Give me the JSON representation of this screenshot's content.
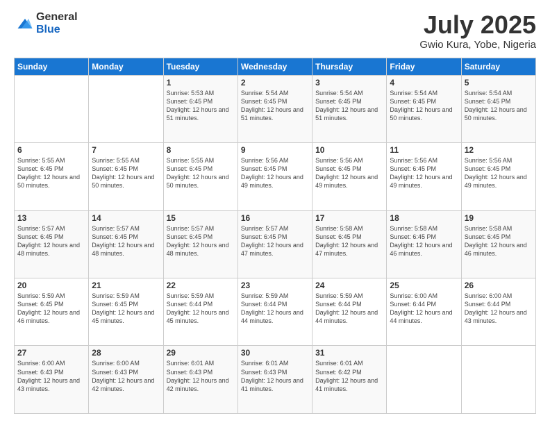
{
  "logo": {
    "general": "General",
    "blue": "Blue"
  },
  "header": {
    "title": "July 2025",
    "subtitle": "Gwio Kura, Yobe, Nigeria"
  },
  "weekdays": [
    "Sunday",
    "Monday",
    "Tuesday",
    "Wednesday",
    "Thursday",
    "Friday",
    "Saturday"
  ],
  "weeks": [
    [
      {
        "day": "",
        "sunrise": "",
        "sunset": "",
        "daylight": ""
      },
      {
        "day": "",
        "sunrise": "",
        "sunset": "",
        "daylight": ""
      },
      {
        "day": "1",
        "sunrise": "Sunrise: 5:53 AM",
        "sunset": "Sunset: 6:45 PM",
        "daylight": "Daylight: 12 hours and 51 minutes."
      },
      {
        "day": "2",
        "sunrise": "Sunrise: 5:54 AM",
        "sunset": "Sunset: 6:45 PM",
        "daylight": "Daylight: 12 hours and 51 minutes."
      },
      {
        "day": "3",
        "sunrise": "Sunrise: 5:54 AM",
        "sunset": "Sunset: 6:45 PM",
        "daylight": "Daylight: 12 hours and 51 minutes."
      },
      {
        "day": "4",
        "sunrise": "Sunrise: 5:54 AM",
        "sunset": "Sunset: 6:45 PM",
        "daylight": "Daylight: 12 hours and 50 minutes."
      },
      {
        "day": "5",
        "sunrise": "Sunrise: 5:54 AM",
        "sunset": "Sunset: 6:45 PM",
        "daylight": "Daylight: 12 hours and 50 minutes."
      }
    ],
    [
      {
        "day": "6",
        "sunrise": "Sunrise: 5:55 AM",
        "sunset": "Sunset: 6:45 PM",
        "daylight": "Daylight: 12 hours and 50 minutes."
      },
      {
        "day": "7",
        "sunrise": "Sunrise: 5:55 AM",
        "sunset": "Sunset: 6:45 PM",
        "daylight": "Daylight: 12 hours and 50 minutes."
      },
      {
        "day": "8",
        "sunrise": "Sunrise: 5:55 AM",
        "sunset": "Sunset: 6:45 PM",
        "daylight": "Daylight: 12 hours and 50 minutes."
      },
      {
        "day": "9",
        "sunrise": "Sunrise: 5:56 AM",
        "sunset": "Sunset: 6:45 PM",
        "daylight": "Daylight: 12 hours and 49 minutes."
      },
      {
        "day": "10",
        "sunrise": "Sunrise: 5:56 AM",
        "sunset": "Sunset: 6:45 PM",
        "daylight": "Daylight: 12 hours and 49 minutes."
      },
      {
        "day": "11",
        "sunrise": "Sunrise: 5:56 AM",
        "sunset": "Sunset: 6:45 PM",
        "daylight": "Daylight: 12 hours and 49 minutes."
      },
      {
        "day": "12",
        "sunrise": "Sunrise: 5:56 AM",
        "sunset": "Sunset: 6:45 PM",
        "daylight": "Daylight: 12 hours and 49 minutes."
      }
    ],
    [
      {
        "day": "13",
        "sunrise": "Sunrise: 5:57 AM",
        "sunset": "Sunset: 6:45 PM",
        "daylight": "Daylight: 12 hours and 48 minutes."
      },
      {
        "day": "14",
        "sunrise": "Sunrise: 5:57 AM",
        "sunset": "Sunset: 6:45 PM",
        "daylight": "Daylight: 12 hours and 48 minutes."
      },
      {
        "day": "15",
        "sunrise": "Sunrise: 5:57 AM",
        "sunset": "Sunset: 6:45 PM",
        "daylight": "Daylight: 12 hours and 48 minutes."
      },
      {
        "day": "16",
        "sunrise": "Sunrise: 5:57 AM",
        "sunset": "Sunset: 6:45 PM",
        "daylight": "Daylight: 12 hours and 47 minutes."
      },
      {
        "day": "17",
        "sunrise": "Sunrise: 5:58 AM",
        "sunset": "Sunset: 6:45 PM",
        "daylight": "Daylight: 12 hours and 47 minutes."
      },
      {
        "day": "18",
        "sunrise": "Sunrise: 5:58 AM",
        "sunset": "Sunset: 6:45 PM",
        "daylight": "Daylight: 12 hours and 46 minutes."
      },
      {
        "day": "19",
        "sunrise": "Sunrise: 5:58 AM",
        "sunset": "Sunset: 6:45 PM",
        "daylight": "Daylight: 12 hours and 46 minutes."
      }
    ],
    [
      {
        "day": "20",
        "sunrise": "Sunrise: 5:59 AM",
        "sunset": "Sunset: 6:45 PM",
        "daylight": "Daylight: 12 hours and 46 minutes."
      },
      {
        "day": "21",
        "sunrise": "Sunrise: 5:59 AM",
        "sunset": "Sunset: 6:45 PM",
        "daylight": "Daylight: 12 hours and 45 minutes."
      },
      {
        "day": "22",
        "sunrise": "Sunrise: 5:59 AM",
        "sunset": "Sunset: 6:44 PM",
        "daylight": "Daylight: 12 hours and 45 minutes."
      },
      {
        "day": "23",
        "sunrise": "Sunrise: 5:59 AM",
        "sunset": "Sunset: 6:44 PM",
        "daylight": "Daylight: 12 hours and 44 minutes."
      },
      {
        "day": "24",
        "sunrise": "Sunrise: 5:59 AM",
        "sunset": "Sunset: 6:44 PM",
        "daylight": "Daylight: 12 hours and 44 minutes."
      },
      {
        "day": "25",
        "sunrise": "Sunrise: 6:00 AM",
        "sunset": "Sunset: 6:44 PM",
        "daylight": "Daylight: 12 hours and 44 minutes."
      },
      {
        "day": "26",
        "sunrise": "Sunrise: 6:00 AM",
        "sunset": "Sunset: 6:44 PM",
        "daylight": "Daylight: 12 hours and 43 minutes."
      }
    ],
    [
      {
        "day": "27",
        "sunrise": "Sunrise: 6:00 AM",
        "sunset": "Sunset: 6:43 PM",
        "daylight": "Daylight: 12 hours and 43 minutes."
      },
      {
        "day": "28",
        "sunrise": "Sunrise: 6:00 AM",
        "sunset": "Sunset: 6:43 PM",
        "daylight": "Daylight: 12 hours and 42 minutes."
      },
      {
        "day": "29",
        "sunrise": "Sunrise: 6:01 AM",
        "sunset": "Sunset: 6:43 PM",
        "daylight": "Daylight: 12 hours and 42 minutes."
      },
      {
        "day": "30",
        "sunrise": "Sunrise: 6:01 AM",
        "sunset": "Sunset: 6:43 PM",
        "daylight": "Daylight: 12 hours and 41 minutes."
      },
      {
        "day": "31",
        "sunrise": "Sunrise: 6:01 AM",
        "sunset": "Sunset: 6:42 PM",
        "daylight": "Daylight: 12 hours and 41 minutes."
      },
      {
        "day": "",
        "sunrise": "",
        "sunset": "",
        "daylight": ""
      },
      {
        "day": "",
        "sunrise": "",
        "sunset": "",
        "daylight": ""
      }
    ]
  ]
}
